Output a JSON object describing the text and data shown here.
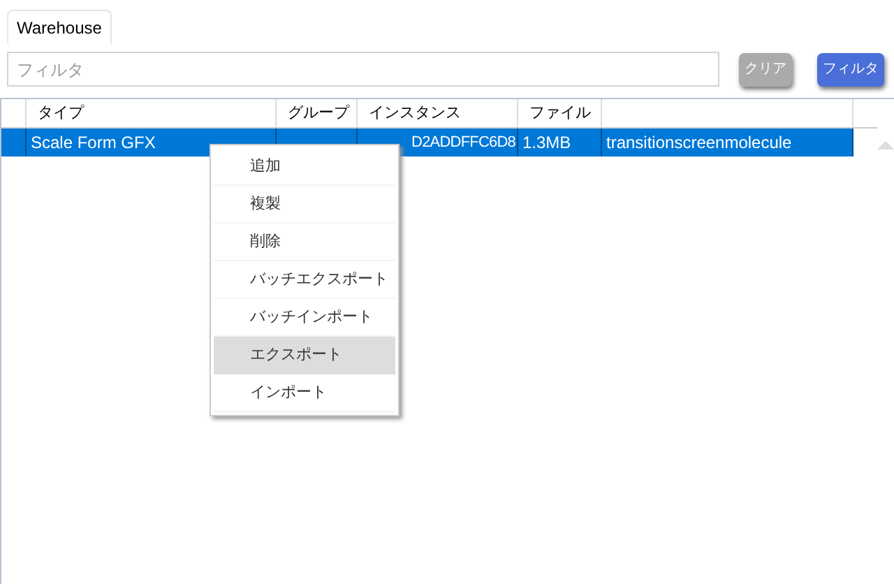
{
  "tabs": [
    {
      "label": "Warehouse",
      "selected": true
    }
  ],
  "filter": {
    "placeholder": "フィルタ"
  },
  "buttons": [
    {
      "label": "クリア",
      "kind": "secondary"
    },
    {
      "label": "フィルタ",
      "kind": "primary"
    }
  ],
  "table": {
    "columns": [
      "タイプ",
      "グループ",
      "インスタンス",
      "ファイル"
    ],
    "rows": [
      {
        "selected": true,
        "cells": [
          "Scale Form GFX",
          "",
          "D2ADDFFC6D8",
          "1.3MB",
          "transitionscreenmolecule"
        ]
      }
    ]
  },
  "context_menu": {
    "items": [
      {
        "label": "追加",
        "selected": false
      },
      {
        "label": "複製",
        "selected": false
      },
      {
        "label": "削除",
        "selected": false
      },
      {
        "label": "バッチエクスポート",
        "selected": false
      },
      {
        "label": "バッチインポート",
        "selected": false
      },
      {
        "label": "エクスポート",
        "selected": true
      },
      {
        "label": "インポート",
        "selected": false
      }
    ]
  }
}
